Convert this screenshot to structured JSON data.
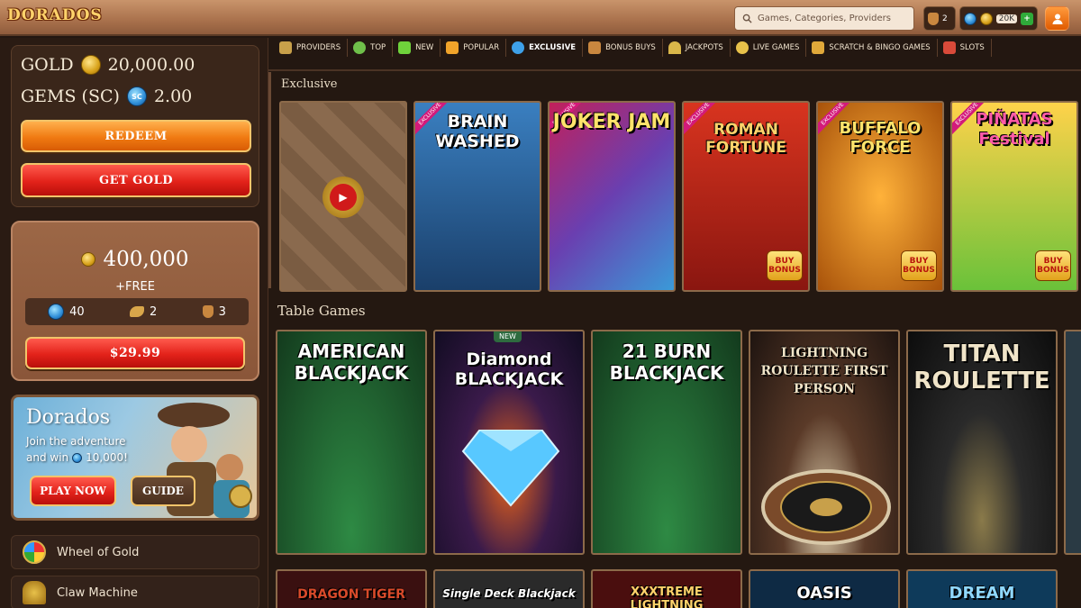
{
  "header": {
    "logo": "DORADOS",
    "search_placeholder": "Games, Categories, Providers",
    "bag_count": "2",
    "coins_short": "20K",
    "plus": "+"
  },
  "balances": {
    "gold_label": "GOLD",
    "gold_value": "20,000.00",
    "gems_label": "GEMS (SC)",
    "gems_value": "2.00",
    "gem_badge": "SC"
  },
  "buttons": {
    "redeem": "REDEEM",
    "get_gold": "GET GOLD"
  },
  "offer": {
    "amount": "400,000",
    "free": "+FREE",
    "gems": "40",
    "item2": "2",
    "item3": "3",
    "price": "$29.99"
  },
  "promo": {
    "title": "Dorados",
    "line1": "Join the adventure",
    "line2": "and win",
    "amount": "10,000!",
    "play": "PLAY NOW",
    "guide": "GUIDE"
  },
  "side_items": [
    {
      "label": "Wheel of Gold"
    },
    {
      "label": "Claw Machine"
    }
  ],
  "nav": [
    {
      "label": "Providers",
      "color": "#c8a04a"
    },
    {
      "label": "Top",
      "color": "#6fbf4a"
    },
    {
      "label": "New",
      "color": "#6fd23b"
    },
    {
      "label": "Popular",
      "color": "#f0a32a"
    },
    {
      "label": "Exclusive",
      "color": "#3ea0e8"
    },
    {
      "label": "Bonus Buys",
      "color": "#c9873f"
    },
    {
      "label": "Jackpots",
      "color": "#d9b64a"
    },
    {
      "label": "Live Games",
      "color": "#e8c14a"
    },
    {
      "label": "Scratch & Bingo Games",
      "color": "#e0a83a"
    },
    {
      "label": "Slots",
      "color": "#d94a3a"
    }
  ],
  "sections": {
    "exclusive": "Exclusive",
    "table": "Table Games"
  },
  "exclusive_games": [
    {
      "name": "",
      "bg": "#8a6a4e"
    },
    {
      "name": "BRAIN WASHED",
      "bg": "#2a5f9a",
      "tag": "EXCLUSIVE"
    },
    {
      "name": "JOKER JAM",
      "bg": "#6a3fb0",
      "tag": "EXCLUSIVE"
    },
    {
      "name": "ROMAN FORTUNE",
      "bg": "#b8241a",
      "tag": "EXCLUSIVE",
      "bonus": "BUY BONUS"
    },
    {
      "name": "BUFFALO FORCE",
      "bg": "#c97a12",
      "tag": "EXCLUSIVE",
      "bonus": "BUY BONUS"
    },
    {
      "name": "PIÑATAS Festival",
      "bg": "#e0b02a",
      "tag": "EXCLUSIVE",
      "bonus": "BUY BONUS"
    }
  ],
  "table_games": [
    {
      "name": "AMERICAN BLACKJACK",
      "bg": "#1f5b2e"
    },
    {
      "name": "Diamond BLACKJACK",
      "bg": "#1a1430",
      "tag": "NEW"
    },
    {
      "name": "21 BURN BLACKJACK",
      "bg": "#1f5b2e"
    },
    {
      "name": "LIGHTNING ROULETTE FIRST PERSON",
      "bg": "#2a1f18"
    },
    {
      "name": "TITAN ROULETTE",
      "bg": "#1a1a1a"
    },
    {
      "name": "",
      "bg": "#243a4a"
    }
  ],
  "bottom_row": [
    {
      "name": "DRAGON TIGER",
      "bg": "#3a1010"
    },
    {
      "name": "Single Deck Blackjack",
      "bg": "#2a2a2a"
    },
    {
      "name": "XXXTREME LIGHTNING",
      "bg": "#4a0e0e"
    },
    {
      "name": "OASIS",
      "bg": "#0e2a44"
    },
    {
      "name": "DREAM",
      "bg": "#0e3a5a"
    }
  ]
}
